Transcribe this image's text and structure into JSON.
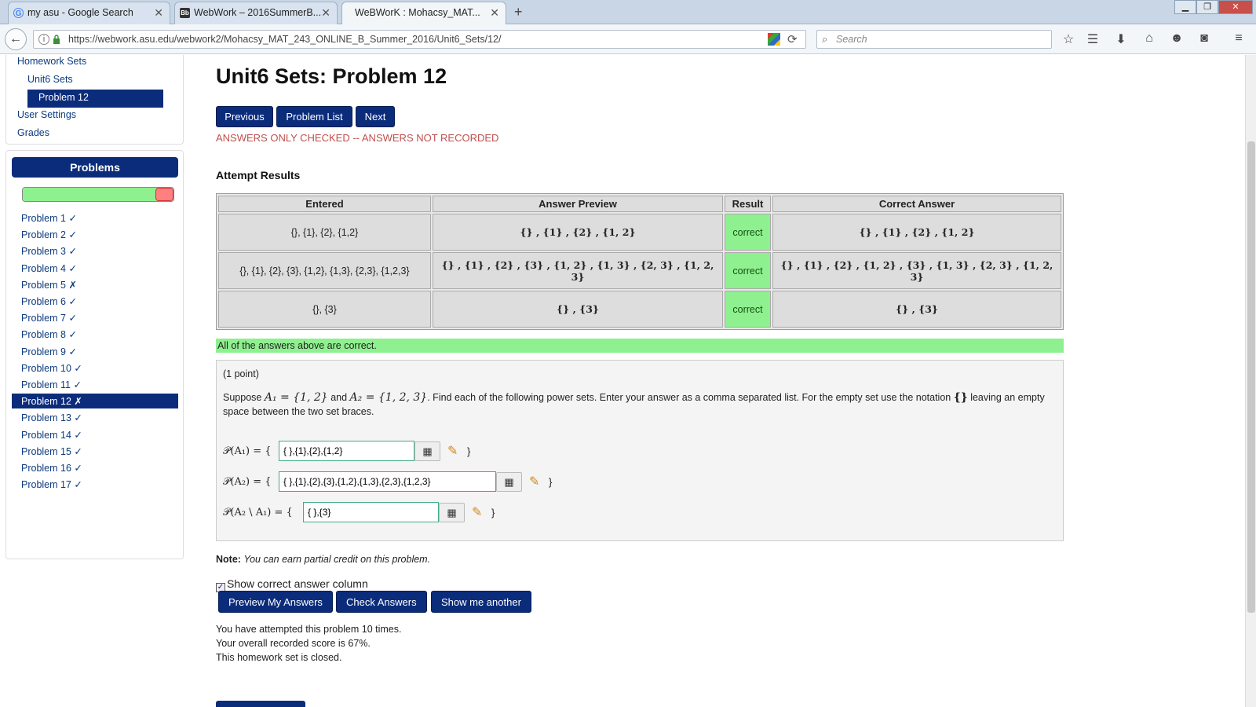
{
  "browser": {
    "tabs": [
      {
        "label": "my asu - Google Search",
        "icon": "google-icon"
      },
      {
        "label": "WebWork – 2016SummerB...",
        "icon": "blackboard-icon"
      },
      {
        "label": "WeBWorK : Mohacsy_MAT...",
        "icon": "webwork-icon"
      }
    ],
    "url": "https://webwork.asu.edu/webwork2/Mohacsy_MAT_243_ONLINE_B_Summer_2016/Unit6_Sets/12/",
    "search_placeholder": "Search"
  },
  "sidebar": {
    "homework_sets": "Homework Sets",
    "unit_sets": "Unit6 Sets",
    "current_problem": "Problem 12",
    "user_settings": "User Settings",
    "grades": "Grades",
    "problems_header": "Problems",
    "progress": {
      "correct_fraction": 0.94,
      "incorrect_fraction": 0.06
    },
    "problems": [
      "Problem 1 ✓",
      "Problem 2 ✓",
      "Problem 3 ✓",
      "Problem 4 ✓",
      "Problem 5 ✗",
      "Problem 6 ✓",
      "Problem 7 ✓",
      "Problem 8 ✓",
      "Problem 9 ✓",
      "Problem 10 ✓",
      "Problem 11 ✓",
      "Problem 12 ✗",
      "Problem 13 ✓",
      "Problem 14 ✓",
      "Problem 15 ✓",
      "Problem 16 ✓",
      "Problem 17 ✓"
    ]
  },
  "main": {
    "title": "Unit6 Sets: Problem 12",
    "buttons": {
      "previous": "Previous",
      "problem_list": "Problem List",
      "next": "Next"
    },
    "status": "ANSWERS ONLY CHECKED -- ANSWERS NOT RECORDED",
    "attempt_results_title": "Attempt Results",
    "results": {
      "headers": [
        "Entered",
        "Answer Preview",
        "Result",
        "Correct Answer"
      ],
      "rows": [
        {
          "entered": "{}, {1}, {2}, {1,2}",
          "preview": "{} , {1} , {2} , {1, 2}",
          "result": "correct",
          "correct": "{} , {1} , {2} , {1, 2}"
        },
        {
          "entered": "{}, {1}, {2}, {3}, {1,2}, {1,3}, {2,3}, {1,2,3}",
          "preview": "{} , {1} , {2} , {3} , {1, 2} , {1, 3} , {2, 3} , {1, 2, 3}",
          "result": "correct",
          "correct": "{} , {1} , {2} , {1, 2} , {3} , {1, 3} , {2, 3} , {1, 2, 3}"
        },
        {
          "entered": "{}, {3}",
          "preview": "{} , {3}",
          "result": "correct",
          "correct": "{} , {3}"
        }
      ]
    },
    "all_correct": "All of the answers above are correct.",
    "problem": {
      "points": "(1 point)",
      "statement_1": "Suppose ",
      "a1_def": "A₁ = {1, 2}",
      "statement_2": " and ",
      "a2_def": "A₂ = {1, 2, 3}",
      "statement_3": ". Find each of the following power sets. Enter your answer as a comma separated list. For the empty set use the notation ",
      "empty_set": "{}",
      "statement_4": " leaving an empty space between the two set braces.",
      "answers": [
        {
          "label": "𝒫(A₁) = {",
          "value": "{ },{1},{2},{1,2}"
        },
        {
          "label": "𝒫(A₂) = {",
          "value": "{ },{1},{2},{3},{1,2},{1,3},{2,3},{1,2,3}"
        },
        {
          "label": "𝒫(A₂ \\ A₁) = {",
          "value": "{ },{3}"
        }
      ],
      "close_brace": "}"
    },
    "note_label": "Note:",
    "note_text": "You can earn partial credit on this problem.",
    "show_correct_label": "Show correct answer column",
    "action_buttons": {
      "preview": "Preview My Answers",
      "check": "Check Answers",
      "another": "Show me another"
    },
    "summary": [
      "You have attempted this problem 10 times.",
      "Your overall recorded score is 67%.",
      "This homework set is closed."
    ]
  }
}
